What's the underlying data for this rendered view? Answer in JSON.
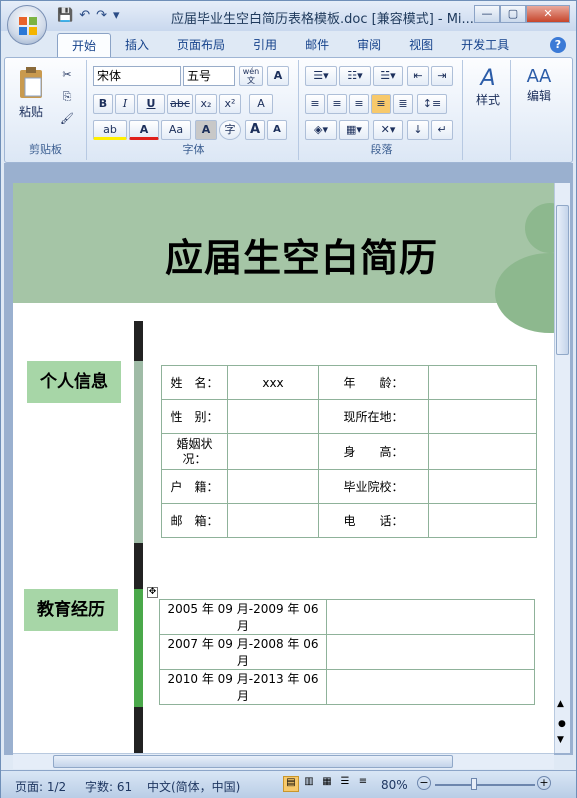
{
  "window": {
    "title": "应届毕业生空白简历表格模板.doc [兼容模式] - Mi...",
    "min": "—",
    "max": "▢",
    "close": "✕"
  },
  "qat": {
    "save": "💾",
    "undo": "↶",
    "redo": "↷",
    "more": "▾"
  },
  "tabs": [
    "开始",
    "插入",
    "页面布局",
    "引用",
    "邮件",
    "审阅",
    "视图",
    "开发工具"
  ],
  "help": "?",
  "ribbon": {
    "clipboard": {
      "label": "剪贴板",
      "paste": "粘贴"
    },
    "font": {
      "label": "字体",
      "name": "宋体",
      "size": "五号",
      "bold": "B",
      "italic": "I",
      "underline": "U",
      "strike": "abc",
      "sub": "x₂",
      "sup": "x²",
      "highlight": "ab",
      "color": "A",
      "case": "Aa",
      "grow": "A",
      "shrink": "A",
      "clear": "A",
      "border": "A",
      "circle": "字",
      "phonetic": "wén 文"
    },
    "paragraph": {
      "label": "段落"
    },
    "styles": {
      "label": "样式"
    },
    "edit": {
      "label": "编辑"
    }
  },
  "doc": {
    "title": "应届生空白简历",
    "section1": "个人信息",
    "section2": "教育经历",
    "info": [
      [
        "姓　名：",
        "xxx",
        "年　　龄：",
        ""
      ],
      [
        "性　别：",
        "",
        "现所在地：",
        ""
      ],
      [
        "婚姻状况：",
        "",
        "身　　高：",
        ""
      ],
      [
        "户　籍：",
        "",
        "毕业院校：",
        ""
      ],
      [
        "邮　箱：",
        "",
        "电　　话：",
        ""
      ]
    ],
    "education": [
      [
        "2005 年 09 月-2009 年 06 月",
        ""
      ],
      [
        "2007 年 09 月-2008 年 06 月",
        ""
      ],
      [
        "2010 年 09 月-2013 年 06 月",
        ""
      ]
    ]
  },
  "status": {
    "page": "页面: 1/2",
    "words": "字数: 61",
    "lang": "中文(简体，中国)",
    "zoom": "80%",
    "zoom_level_percent": 80
  },
  "colors": {
    "banner": "#a5c5a6",
    "label_bg": "#a7d6a7",
    "bar_green": "#4aa84a",
    "bar_gray": "#9fbba6",
    "bar_dark": "#222222"
  }
}
